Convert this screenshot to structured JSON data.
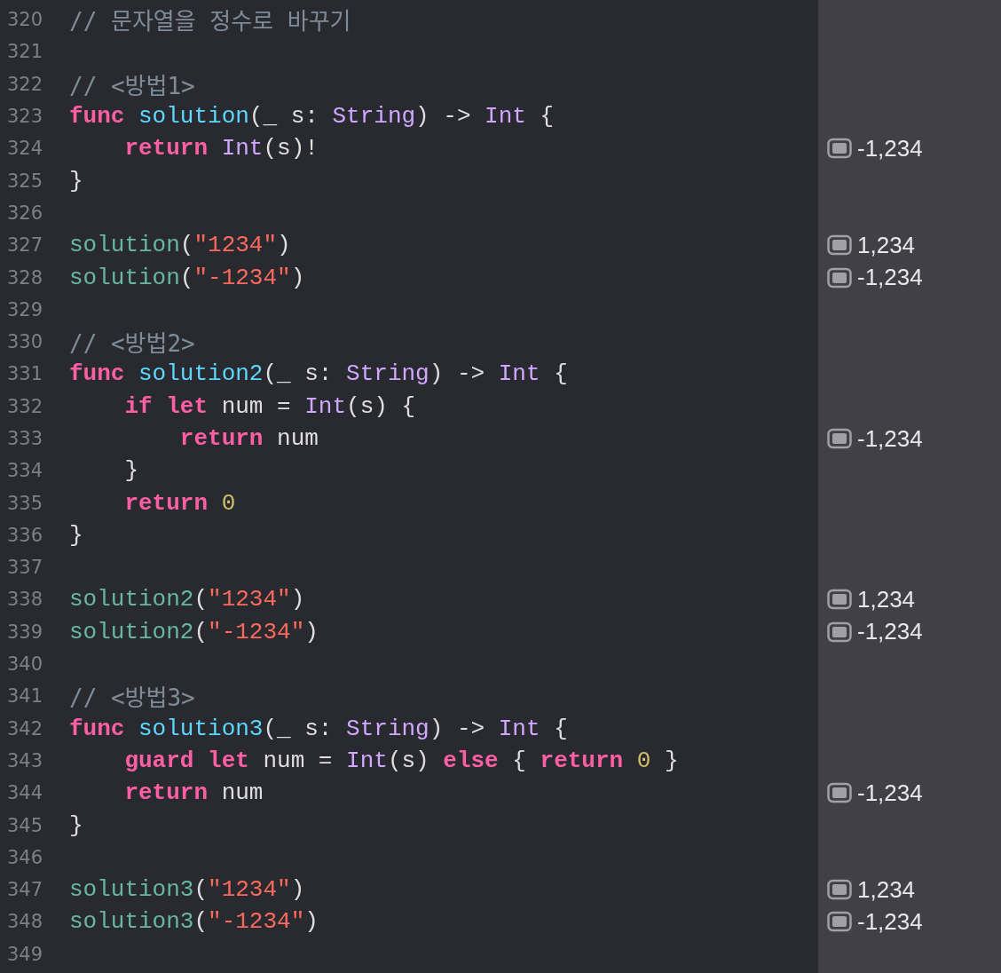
{
  "lines": [
    {
      "number": "320",
      "tokens": [
        {
          "kind": "comment",
          "text": "// 문자열을 정수로 바꾸기"
        }
      ]
    },
    {
      "number": "321"
    },
    {
      "number": "322",
      "tokens": [
        {
          "kind": "comment",
          "text": "// <방법1>"
        }
      ]
    },
    {
      "number": "323",
      "tokens": [
        {
          "kind": "keyword",
          "text": "func "
        },
        {
          "kind": "decl",
          "text": "solution"
        },
        {
          "kind": "plain",
          "text": "(_ s: "
        },
        {
          "kind": "type",
          "text": "String"
        },
        {
          "kind": "plain",
          "text": ") -> "
        },
        {
          "kind": "type",
          "text": "Int"
        },
        {
          "kind": "plain",
          "text": " {"
        }
      ]
    },
    {
      "number": "324",
      "tokens": [
        {
          "kind": "keyword",
          "text": "    return "
        },
        {
          "kind": "type",
          "text": "Int"
        },
        {
          "kind": "plain",
          "text": "(s)!"
        }
      ],
      "result": "-1,234"
    },
    {
      "number": "325",
      "tokens": [
        {
          "kind": "plain",
          "text": "}"
        }
      ]
    },
    {
      "number": "326"
    },
    {
      "number": "327",
      "tokens": [
        {
          "kind": "call",
          "text": "solution"
        },
        {
          "kind": "plain",
          "text": "("
        },
        {
          "kind": "string",
          "text": "\"1234\""
        },
        {
          "kind": "plain",
          "text": ")"
        }
      ],
      "result": "1,234"
    },
    {
      "number": "328",
      "tokens": [
        {
          "kind": "call",
          "text": "solution"
        },
        {
          "kind": "plain",
          "text": "("
        },
        {
          "kind": "string",
          "text": "\"-1234\""
        },
        {
          "kind": "plain",
          "text": ")"
        }
      ],
      "result": "-1,234"
    },
    {
      "number": "329"
    },
    {
      "number": "330",
      "tokens": [
        {
          "kind": "comment",
          "text": "// <방법2>"
        }
      ]
    },
    {
      "number": "331",
      "tokens": [
        {
          "kind": "keyword",
          "text": "func "
        },
        {
          "kind": "decl",
          "text": "solution2"
        },
        {
          "kind": "plain",
          "text": "(_ s: "
        },
        {
          "kind": "type",
          "text": "String"
        },
        {
          "kind": "plain",
          "text": ") -> "
        },
        {
          "kind": "type",
          "text": "Int"
        },
        {
          "kind": "plain",
          "text": " {"
        }
      ]
    },
    {
      "number": "332",
      "tokens": [
        {
          "kind": "keyword",
          "text": "    if let"
        },
        {
          "kind": "plain",
          "text": " num = "
        },
        {
          "kind": "type",
          "text": "Int"
        },
        {
          "kind": "plain",
          "text": "(s) {"
        }
      ]
    },
    {
      "number": "333",
      "tokens": [
        {
          "kind": "keyword",
          "text": "        return"
        },
        {
          "kind": "plain",
          "text": " num"
        }
      ],
      "result": "-1,234"
    },
    {
      "number": "334",
      "tokens": [
        {
          "kind": "plain",
          "text": "    }"
        }
      ]
    },
    {
      "number": "335",
      "tokens": [
        {
          "kind": "keyword",
          "text": "    return "
        },
        {
          "kind": "number",
          "text": "0"
        }
      ]
    },
    {
      "number": "336",
      "tokens": [
        {
          "kind": "plain",
          "text": "}"
        }
      ]
    },
    {
      "number": "337"
    },
    {
      "number": "338",
      "tokens": [
        {
          "kind": "call",
          "text": "solution2"
        },
        {
          "kind": "plain",
          "text": "("
        },
        {
          "kind": "string",
          "text": "\"1234\""
        },
        {
          "kind": "plain",
          "text": ")"
        }
      ],
      "result": "1,234"
    },
    {
      "number": "339",
      "tokens": [
        {
          "kind": "call",
          "text": "solution2"
        },
        {
          "kind": "plain",
          "text": "("
        },
        {
          "kind": "string",
          "text": "\"-1234\""
        },
        {
          "kind": "plain",
          "text": ")"
        }
      ],
      "result": "-1,234"
    },
    {
      "number": "340"
    },
    {
      "number": "341",
      "tokens": [
        {
          "kind": "comment",
          "text": "// <방법3>"
        }
      ]
    },
    {
      "number": "342",
      "tokens": [
        {
          "kind": "keyword",
          "text": "func "
        },
        {
          "kind": "decl",
          "text": "solution3"
        },
        {
          "kind": "plain",
          "text": "(_ s: "
        },
        {
          "kind": "type",
          "text": "String"
        },
        {
          "kind": "plain",
          "text": ") -> "
        },
        {
          "kind": "type",
          "text": "Int"
        },
        {
          "kind": "plain",
          "text": " {"
        }
      ]
    },
    {
      "number": "343",
      "tokens": [
        {
          "kind": "keyword",
          "text": "    guard let"
        },
        {
          "kind": "plain",
          "text": " num = "
        },
        {
          "kind": "type",
          "text": "Int"
        },
        {
          "kind": "plain",
          "text": "(s) "
        },
        {
          "kind": "keyword",
          "text": "else"
        },
        {
          "kind": "plain",
          "text": " { "
        },
        {
          "kind": "keyword",
          "text": "return "
        },
        {
          "kind": "number",
          "text": "0"
        },
        {
          "kind": "plain",
          "text": " }"
        }
      ]
    },
    {
      "number": "344",
      "tokens": [
        {
          "kind": "keyword",
          "text": "    return"
        },
        {
          "kind": "plain",
          "text": " num"
        }
      ],
      "result": "-1,234"
    },
    {
      "number": "345",
      "tokens": [
        {
          "kind": "plain",
          "text": "}"
        }
      ]
    },
    {
      "number": "346"
    },
    {
      "number": "347",
      "tokens": [
        {
          "kind": "call",
          "text": "solution3"
        },
        {
          "kind": "plain",
          "text": "("
        },
        {
          "kind": "string",
          "text": "\"1234\""
        },
        {
          "kind": "plain",
          "text": ")"
        }
      ],
      "result": "1,234"
    },
    {
      "number": "348",
      "tokens": [
        {
          "kind": "call",
          "text": "solution3"
        },
        {
          "kind": "plain",
          "text": "("
        },
        {
          "kind": "string",
          "text": "\"-1234\""
        },
        {
          "kind": "plain",
          "text": ")"
        }
      ],
      "result": "-1,234"
    },
    {
      "number": "349"
    }
  ]
}
